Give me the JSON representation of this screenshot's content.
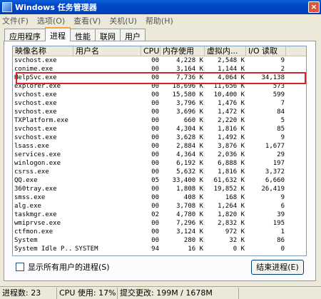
{
  "window": {
    "title": "Windows 任务管理器",
    "close_glyph": "×"
  },
  "menu": [
    "文件(F)",
    "选项(O)",
    "查看(V)",
    "关机(U)",
    "帮助(H)"
  ],
  "tabs": [
    "应用程序",
    "进程",
    "性能",
    "联网",
    "用户"
  ],
  "active_tab": "进程",
  "columns": [
    "映像名称",
    "用户名",
    "CPU",
    "内存使用",
    "虚拟内...",
    "I/O 读取"
  ],
  "processes": [
    [
      "svchost.exe",
      "",
      "00",
      "4,228 K",
      "2,548 K",
      "9"
    ],
    [
      "conime.exe",
      "",
      "00",
      "3,164 K",
      "1,144 K",
      "2"
    ],
    [
      "HelpSvc.exe",
      "",
      "00",
      "7,736 K",
      "4,064 K",
      "34,138"
    ],
    [
      "explorer.exe",
      "",
      "00",
      "18,696 K",
      "11,656 K",
      "573"
    ],
    [
      "svchost.exe",
      "",
      "00",
      "15,580 K",
      "10,400 K",
      "599"
    ],
    [
      "svchost.exe",
      "",
      "00",
      "3,796 K",
      "1,476 K",
      "7"
    ],
    [
      "svchost.exe",
      "",
      "00",
      "3,696 K",
      "1,472 K",
      "84"
    ],
    [
      "TXPlatform.exe",
      "",
      "00",
      "660 K",
      "2,220 K",
      "5"
    ],
    [
      "svchost.exe",
      "",
      "00",
      "4,304 K",
      "1,816 K",
      "85"
    ],
    [
      "svchost.exe",
      "",
      "00",
      "3,628 K",
      "1,492 K",
      "9"
    ],
    [
      "lsass.exe",
      "",
      "00",
      "2,884 K",
      "3,876 K",
      "1,677"
    ],
    [
      "services.exe",
      "",
      "00",
      "4,364 K",
      "2,036 K",
      "29"
    ],
    [
      "winlogon.exe",
      "",
      "00",
      "6,192 K",
      "6,888 K",
      "197"
    ],
    [
      "csrss.exe",
      "",
      "00",
      "5,632 K",
      "1,816 K",
      "3,372"
    ],
    [
      "QQ.exe",
      "",
      "05",
      "33,400 K",
      "61,632 K",
      "6,660"
    ],
    [
      "360tray.exe",
      "",
      "00",
      "1,808 K",
      "19,852 K",
      "26,419"
    ],
    [
      "smss.exe",
      "",
      "00",
      "408 K",
      "168 K",
      "9"
    ],
    [
      "alg.exe",
      "",
      "00",
      "3,708 K",
      "1,264 K",
      "6"
    ],
    [
      "taskmgr.exe",
      "",
      "02",
      "4,780 K",
      "1,820 K",
      "39"
    ],
    [
      "wmiprvse.exe",
      "",
      "00",
      "7,296 K",
      "2,832 K",
      "195"
    ],
    [
      "ctfmon.exe",
      "",
      "00",
      "3,124 K",
      "972 K",
      "1"
    ],
    [
      "System",
      "",
      "00",
      "280 K",
      "32 K",
      "86"
    ],
    [
      "System Idle P...",
      "SYSTEM",
      "94",
      "16 K",
      "0 K",
      "0"
    ]
  ],
  "highlighted_process": "HelpSvc.exe",
  "show_all_users_label": "显示所有用户的进程(S)",
  "end_process_label": "结束进程(E)",
  "status": {
    "processes": "进程数: 23",
    "cpu": "CPU 使用: 17%",
    "commit": "提交更改: 199M / 1678M"
  }
}
